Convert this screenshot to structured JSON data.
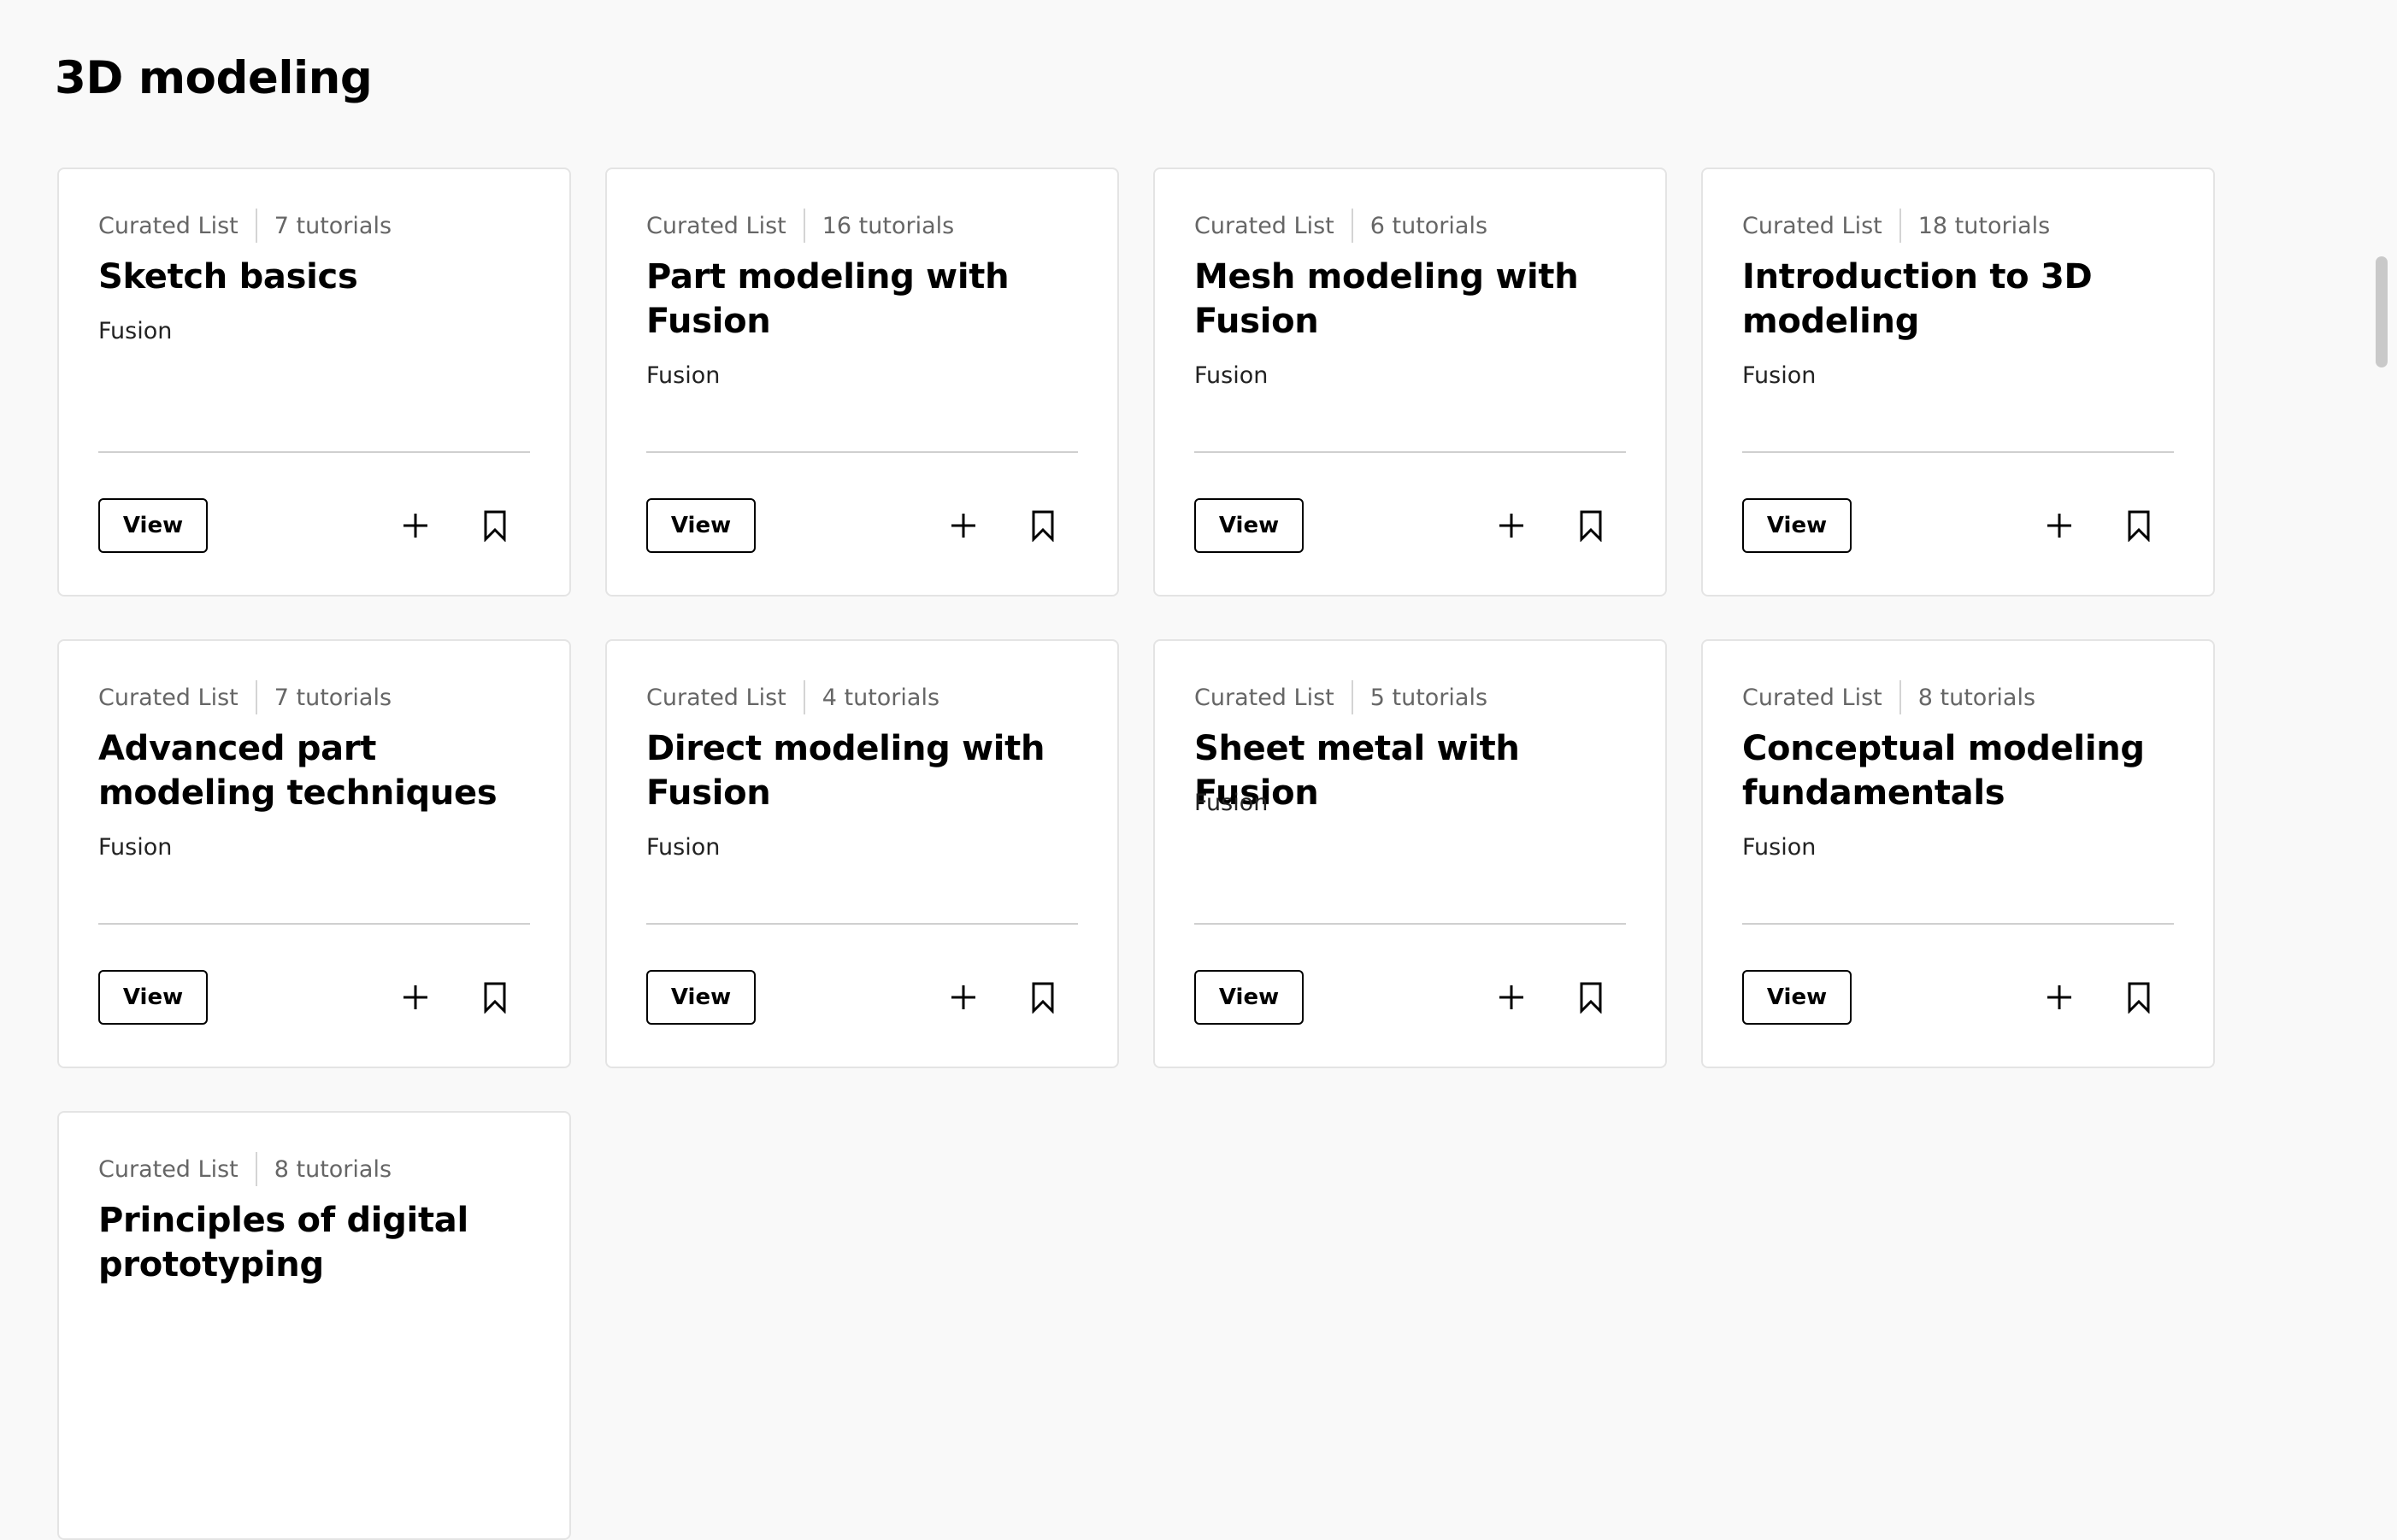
{
  "page": {
    "title": "3D modeling"
  },
  "colors": {
    "background": "#f9f9f9",
    "card": "#ffffff",
    "card_border": "#e4e4e4",
    "meta_text": "#666666",
    "divider": "#cfcfcf",
    "accent": "#000000"
  },
  "icons": {
    "add": "plus-icon",
    "save": "bookmark-icon"
  },
  "cards": [
    {
      "type": "Curated List",
      "count": "7 tutorials",
      "title": "Sketch basics",
      "product": "Fusion",
      "view_label": "View"
    },
    {
      "type": "Curated List",
      "count": "16 tutorials",
      "title": "Part modeling with Fusion",
      "product": "Fusion",
      "view_label": "View"
    },
    {
      "type": "Curated List",
      "count": "6 tutorials",
      "title": "Mesh modeling with Fusion",
      "product": "Fusion",
      "view_label": "View"
    },
    {
      "type": "Curated List",
      "count": "18 tutorials",
      "title": "Introduction to 3D modeling",
      "product": "Fusion",
      "view_label": "View"
    },
    {
      "type": "Curated List",
      "count": "7 tutorials",
      "title": "Advanced part modeling techniques",
      "product": "Fusion",
      "view_label": "View"
    },
    {
      "type": "Curated List",
      "count": "4 tutorials",
      "title": "Direct modeling with Fusion",
      "product": "Fusion",
      "view_label": "View"
    },
    {
      "type": "Curated List",
      "count": "5 tutorials",
      "title": "Sheet metal with Fusion",
      "product": "Fusion",
      "view_label": "View"
    },
    {
      "type": "Curated List",
      "count": "8 tutorials",
      "title": "Conceptual modeling fundamentals",
      "product": "Fusion",
      "view_label": "View"
    },
    {
      "type": "Curated List",
      "count": "8 tutorials",
      "title": "Principles of digital prototyping"
    }
  ]
}
